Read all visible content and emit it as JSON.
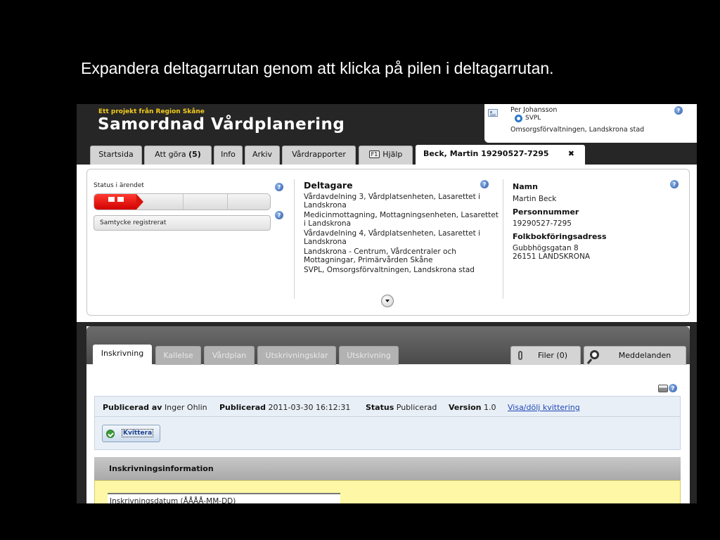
{
  "slide": {
    "caption": "Expandera deltagarrutan genom att klicka på pilen i deltagarrutan."
  },
  "header": {
    "brand_tag": "Ett projekt från Region Skåne",
    "brand_title": "Samordnad Vårdplanering"
  },
  "user": {
    "name": "Per Johansson",
    "org": "SVPL",
    "department": "Omsorgsförvaltningen, Landskrona stad"
  },
  "tabs": {
    "start": "Startsida",
    "todo": "Att göra ",
    "todo_count": "(5)",
    "info": "Info",
    "archive": "Arkiv",
    "reports": "Vårdrapporter",
    "help_key": "F1",
    "help": "Hjälp",
    "patient": "Beck, Martin 19290527-7295",
    "close": "✖"
  },
  "status": {
    "label": "Status i ärendet",
    "progress": 0.24,
    "consent": "Samtycke registrerat"
  },
  "participants": {
    "title": "Deltagare",
    "items": [
      "Vårdavdelning 3, Vårdplatsenheten, Lasarettet i Landskrona",
      "Medicinmottagning, Mottagningsenheten, Lasarettet i Landskrona",
      "Vårdavdelning 4, Vårdplatsenheten, Lasarettet i Landskrona",
      "Landskrona - Centrum, Vårdcentraler och Mottagningar, Primärvården Skåne",
      "SVPL, Omsorgsförvaltningen, Landskrona stad"
    ]
  },
  "patient": {
    "name_label": "Namn",
    "name": "Martin Beck",
    "pnr_label": "Personnummer",
    "pnr": "19290527-7295",
    "address_label": "Folkbokföringsadress",
    "street": "Gubbhögsgatan 8",
    "city": "26151 LANDSKRONA"
  },
  "subtabs": {
    "enrollment": "Inskrivning",
    "summons": "Kallelse",
    "care_plan": "Vårdplan",
    "discharge_ready": "Utskrivningsklar",
    "discharge": "Utskrivning",
    "files": "Filer (0)",
    "messages": "Meddelanden"
  },
  "document": {
    "published_by_label": "Publicerad av",
    "published_by": "Inger Ohlin",
    "published_label": "Publicerad",
    "published": "2011-03-30 16:12:31",
    "status_label": "Status",
    "status": "Publicerad",
    "version_label": "Version",
    "version": "1.0",
    "toggle_link": "Visa/dölj kvittering",
    "ack_button": "Kvittera"
  },
  "enrollment_info": {
    "title": "Inskrivningsinformation",
    "date_label": "Inskrivningsdatum (ÅÅÅÅ-MM-DD)"
  },
  "icons": {
    "help": "?"
  }
}
